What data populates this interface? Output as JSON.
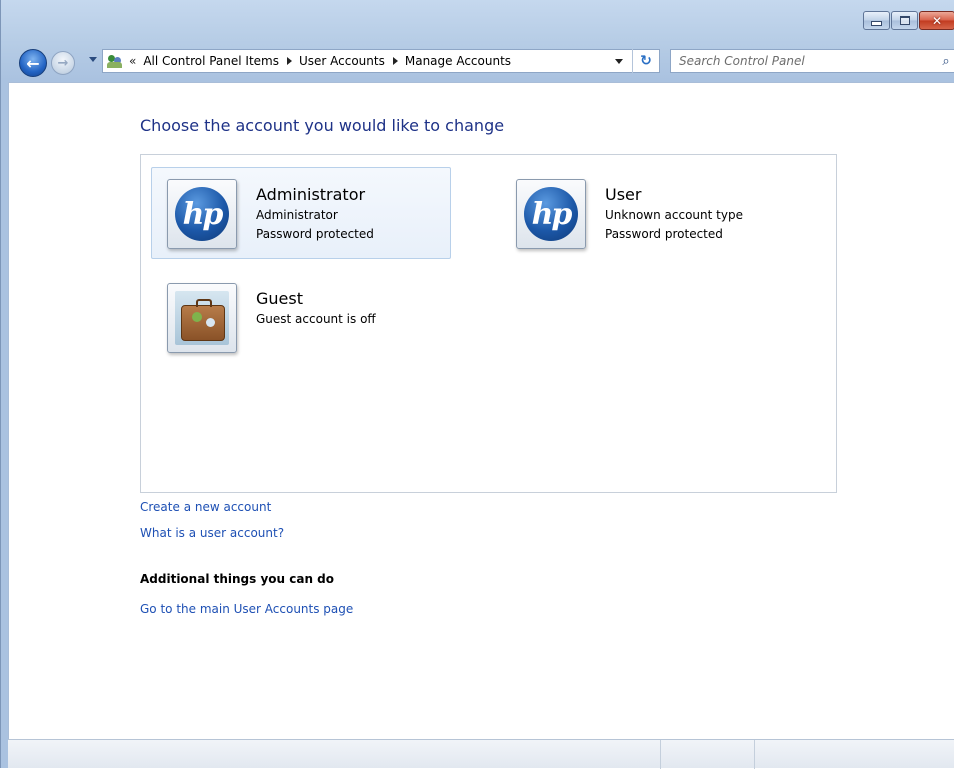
{
  "window": {
    "close_glyph": "✕"
  },
  "nav": {
    "back_glyph": "←",
    "forward_glyph": "→",
    "breadcrumb_prefix": "«",
    "breadcrumbs": [
      "All Control Panel Items",
      "User Accounts",
      "Manage Accounts"
    ],
    "refresh_glyph": "↻"
  },
  "search": {
    "placeholder": "Search Control Panel",
    "icon": "⌕"
  },
  "page": {
    "title": "Choose the account you would like to change"
  },
  "accounts": [
    {
      "name": "Administrator",
      "line1": "Administrator",
      "line2": "Password protected",
      "picture": "hp-logo-icon",
      "logo_text": "hp"
    },
    {
      "name": "User",
      "line1": "Unknown account type",
      "line2": "Password protected",
      "picture": "hp-logo-icon",
      "logo_text": "hp"
    },
    {
      "name": "Guest",
      "line1": "Guest account is off",
      "line2": "",
      "picture": "suitcase-icon"
    }
  ],
  "links": {
    "create_account": "Create a new account",
    "what_is_account": "What is a user account?",
    "additional_heading": "Additional things you can do",
    "main_page": "Go to the main User Accounts page"
  },
  "colors": {
    "title_blue": "#1e3287",
    "link_blue": "#1e50b4"
  }
}
